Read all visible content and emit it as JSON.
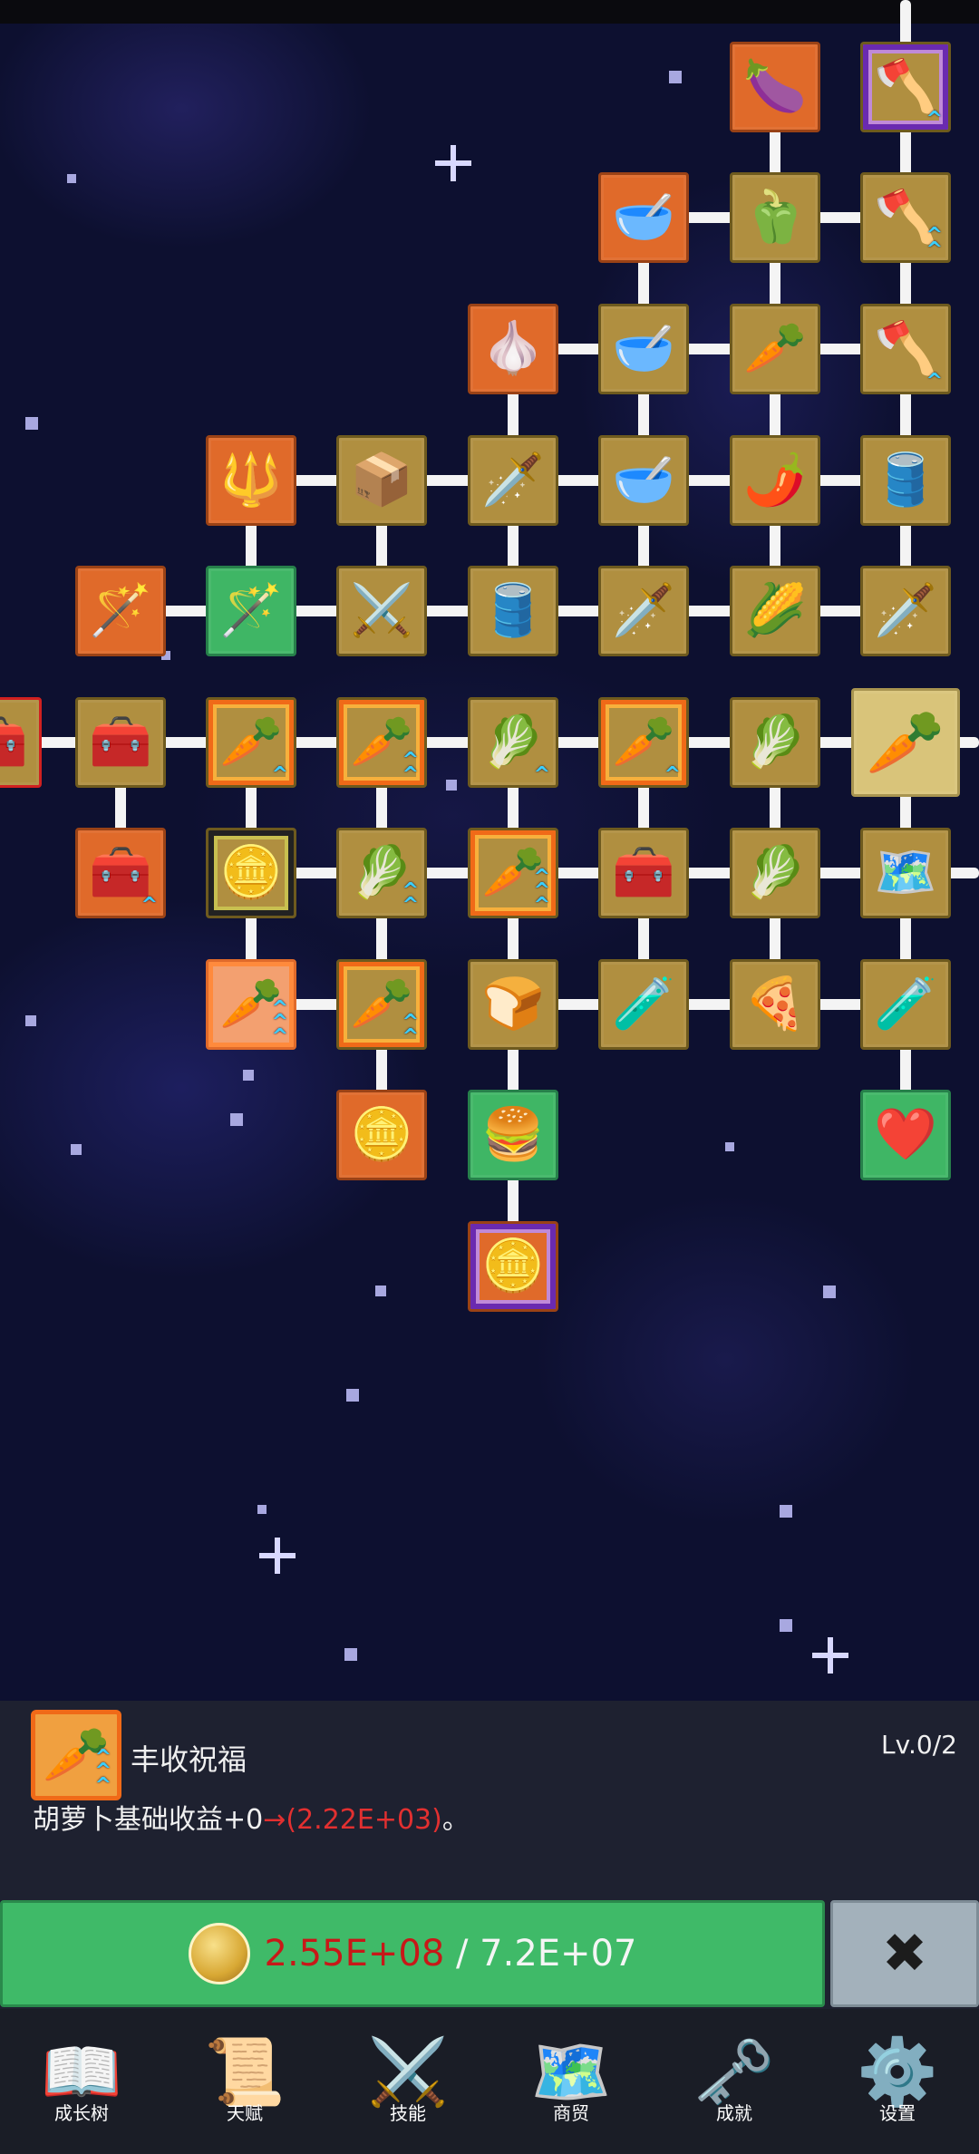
{
  "tree": {
    "nodes": [
      {
        "id": "eggplant",
        "icon": "🍆",
        "style": "orange"
      },
      {
        "id": "shovel-top",
        "icon": "🪓",
        "style": "frame-purple",
        "arrows": "^"
      },
      {
        "id": "bowl-1",
        "icon": "🥣",
        "style": "orange"
      },
      {
        "id": "pepper",
        "icon": "🫑",
        "style": ""
      },
      {
        "id": "shovel-2",
        "icon": "🪓",
        "style": "",
        "arrows": "^^"
      },
      {
        "id": "garlic",
        "icon": "🧄",
        "style": "orange"
      },
      {
        "id": "bowl-2",
        "icon": "🥣",
        "style": ""
      },
      {
        "id": "radish",
        "icon": "🥕",
        "style": ""
      },
      {
        "id": "shovel-3",
        "icon": "🪓",
        "style": "",
        "arrows": "^"
      },
      {
        "id": "blue-staff",
        "icon": "🔱",
        "style": "orange"
      },
      {
        "id": "crate-1",
        "icon": "📦",
        "style": ""
      },
      {
        "id": "golden-sword",
        "icon": "🗡️",
        "style": ""
      },
      {
        "id": "bowl-3",
        "icon": "🥣",
        "style": ""
      },
      {
        "id": "chili",
        "icon": "🌶️",
        "style": ""
      },
      {
        "id": "barrel-1",
        "icon": "🛢️",
        "style": ""
      },
      {
        "id": "red-staff",
        "icon": "🪄",
        "style": "orange"
      },
      {
        "id": "green-staff",
        "icon": "🪄",
        "style": "green"
      },
      {
        "id": "sword-1",
        "icon": "⚔️",
        "style": ""
      },
      {
        "id": "barrel-2",
        "icon": "🛢️",
        "style": ""
      },
      {
        "id": "sword-2",
        "icon": "🗡️",
        "style": ""
      },
      {
        "id": "corn",
        "icon": "🌽",
        "style": ""
      },
      {
        "id": "sword-3",
        "icon": "🗡️",
        "style": ""
      },
      {
        "id": "chest-edge",
        "icon": "🧰",
        "style": "partial"
      },
      {
        "id": "chest-1",
        "icon": "🧰",
        "style": ""
      },
      {
        "id": "carrot-1",
        "icon": "🥕",
        "style": "frame-orange",
        "arrows": "^"
      },
      {
        "id": "carrot-2",
        "icon": "🥕",
        "style": "frame-orange",
        "arrows": "^^"
      },
      {
        "id": "cabbage-1",
        "icon": "🥬",
        "style": "",
        "arrows": "^"
      },
      {
        "id": "carrot-3",
        "icon": "🥕",
        "style": "frame-orange",
        "arrows": "^"
      },
      {
        "id": "cabbage-2",
        "icon": "🥬",
        "style": ""
      },
      {
        "id": "carrot-selected",
        "icon": "🥕",
        "style": "selected"
      },
      {
        "id": "chest-2",
        "icon": "🧰",
        "style": "orange",
        "arrows": "^"
      },
      {
        "id": "coin-1",
        "icon": "🪙",
        "style": "frame-dark"
      },
      {
        "id": "cabbage-3",
        "icon": "🥬",
        "style": "",
        "arrows": "^^"
      },
      {
        "id": "carrot-4",
        "icon": "🥕",
        "style": "frame-orange",
        "arrows": "^^^"
      },
      {
        "id": "chest-3",
        "icon": "🧰",
        "style": ""
      },
      {
        "id": "leek",
        "icon": "🥬",
        "style": ""
      },
      {
        "id": "map",
        "icon": "🗺️",
        "style": ""
      },
      {
        "id": "carrot-5",
        "icon": "🥕",
        "style": "frame-burst",
        "arrows": "^^^"
      },
      {
        "id": "carrot-6",
        "icon": "🥕",
        "style": "frame-orange",
        "arrows": "^^"
      },
      {
        "id": "bread",
        "icon": "🍞",
        "style": ""
      },
      {
        "id": "potion-1",
        "icon": "🧪",
        "style": ""
      },
      {
        "id": "pizza",
        "icon": "🍕",
        "style": ""
      },
      {
        "id": "potion-2",
        "icon": "🧪",
        "style": ""
      },
      {
        "id": "coin-2",
        "icon": "🪙",
        "style": "orange"
      },
      {
        "id": "burger",
        "icon": "🍔",
        "style": "green"
      },
      {
        "id": "heart",
        "icon": "❤️",
        "style": "green"
      },
      {
        "id": "coin-3",
        "icon": "🪙",
        "style": "orange frame-purple"
      }
    ]
  },
  "panel": {
    "icon": "🥕",
    "title": "丰收祝福",
    "level": "Lv.0/2",
    "desc_prefix": "胡萝卜基础收益+0",
    "desc_arrow": "→",
    "desc_value": "(2.22E+03)",
    "desc_suffix": "。"
  },
  "upgrade": {
    "have": "2.55E+08",
    "separator": " / ",
    "cost": "7.2E+07"
  },
  "close_label": "✖",
  "nav": [
    {
      "label": "成长树",
      "icon": "📖"
    },
    {
      "label": "天赋",
      "icon": "📜"
    },
    {
      "label": "技能",
      "icon": "⚔️"
    },
    {
      "label": "商贸",
      "icon": "🗺️"
    },
    {
      "label": "成就",
      "icon": "🗝️"
    },
    {
      "label": "设置",
      "icon": "⚙️"
    }
  ],
  "colors": {
    "space": "#0d1030",
    "node_gold": "#b08f40",
    "node_orange": "#e06a2a",
    "node_green": "#3fb665",
    "button_green": "#3fba68",
    "price_red": "#c81818"
  }
}
